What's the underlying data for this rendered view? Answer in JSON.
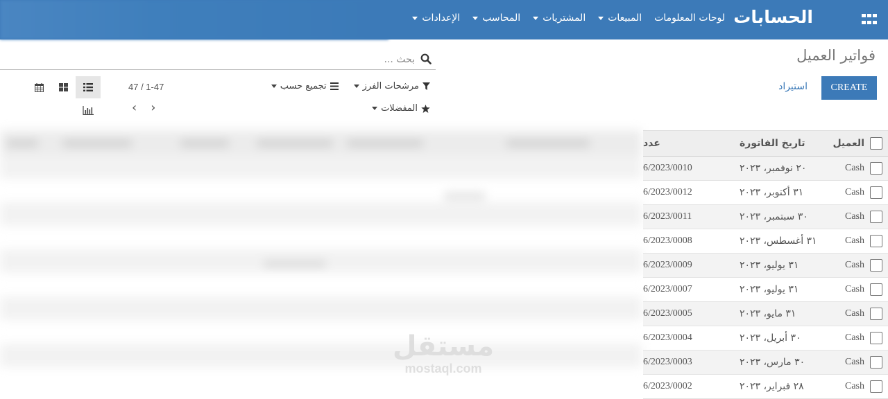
{
  "navbar": {
    "brand": "الحسابات",
    "menu": [
      {
        "label": "لوحات المعلومات",
        "dropdown": false
      },
      {
        "label": "المبيعات",
        "dropdown": true
      },
      {
        "label": "المشتريات",
        "dropdown": true
      },
      {
        "label": "المحاسب",
        "dropdown": true
      },
      {
        "label": "الإعدادات",
        "dropdown": true
      }
    ]
  },
  "control": {
    "title": "فواتير العميل",
    "create_label": "CREATE",
    "import_label": "استيراد",
    "search_placeholder": "بحث ...",
    "filters_label": "مرشحات الفرز",
    "group_by_label": "تجميع حسب",
    "favorites_label": "المفضلات",
    "pager": "47 / 1-47"
  },
  "table": {
    "headers": {
      "partner": "العميل",
      "date": "تاريخ الفاتورة",
      "number": "عدد"
    },
    "rows": [
      {
        "partner": "Cash",
        "date": "٢٠ نوفمبر، ٢٠٢٣",
        "number": "6/2023/0010"
      },
      {
        "partner": "Cash",
        "date": "٣١ أكتوبر، ٢٠٢٣",
        "number": "6/2023/0012"
      },
      {
        "partner": "Cash",
        "date": "٣٠ سبتمبر، ٢٠٢٣",
        "number": "6/2023/0011"
      },
      {
        "partner": "Cash",
        "date": "٣١ أغسطس، ٢٠٢٣",
        "number": "6/2023/0008"
      },
      {
        "partner": "Cash",
        "date": "٣١ يوليو، ٢٠٢٣",
        "number": "6/2023/0009"
      },
      {
        "partner": "Cash",
        "date": "٣١ يوليو، ٢٠٢٣",
        "number": "6/2023/0007"
      },
      {
        "partner": "Cash",
        "date": "٣١ مايو، ٢٠٢٣",
        "number": "6/2023/0005"
      },
      {
        "partner": "Cash",
        "date": "٣٠ أبريل، ٢٠٢٣",
        "number": "6/2023/0004"
      },
      {
        "partner": "Cash",
        "date": "٣٠ مارس، ٢٠٢٣",
        "number": "6/2023/0003"
      },
      {
        "partner": "Cash",
        "date": "٢٨ فبراير، ٢٠٢٣",
        "number": "6/2023/0002"
      }
    ]
  },
  "watermark": {
    "arabic": "مستقل",
    "latin": "mostaql.com"
  },
  "icons": {
    "apps": "apps-grid-icon",
    "search": "search-icon",
    "filter": "filter-icon",
    "group": "group-by-icon",
    "favorite": "star-icon",
    "list_view": "list-view-icon",
    "kanban_view": "kanban-view-icon",
    "calendar_view": "calendar-view-icon",
    "graph_view": "graph-view-icon",
    "prev": "chevron-left-icon",
    "next": "chevron-right-icon"
  },
  "colors": {
    "primary": "#3c7ab8",
    "header_bg": "#eeeeee",
    "row_alt": "#f3f3f3"
  }
}
